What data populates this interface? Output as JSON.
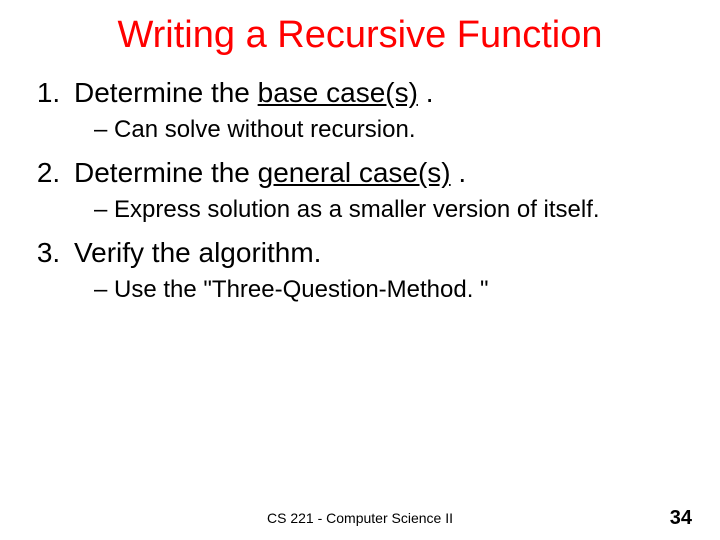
{
  "title": "Writing a Recursive Function",
  "items": [
    {
      "prefix": "Determine the ",
      "underlined": "base case(s)",
      "suffix": " .",
      "sub": "Can solve without recursion."
    },
    {
      "prefix": "Determine the ",
      "underlined": "general case(s)",
      "suffix": " .",
      "sub": "Express solution as a smaller version of itself."
    },
    {
      "prefix": "Verify the algorithm.",
      "underlined": "",
      "suffix": "",
      "sub": "Use the \"Three-Question-Method. \""
    }
  ],
  "footer": "CS 221 - Computer Science II",
  "page_number": "34"
}
